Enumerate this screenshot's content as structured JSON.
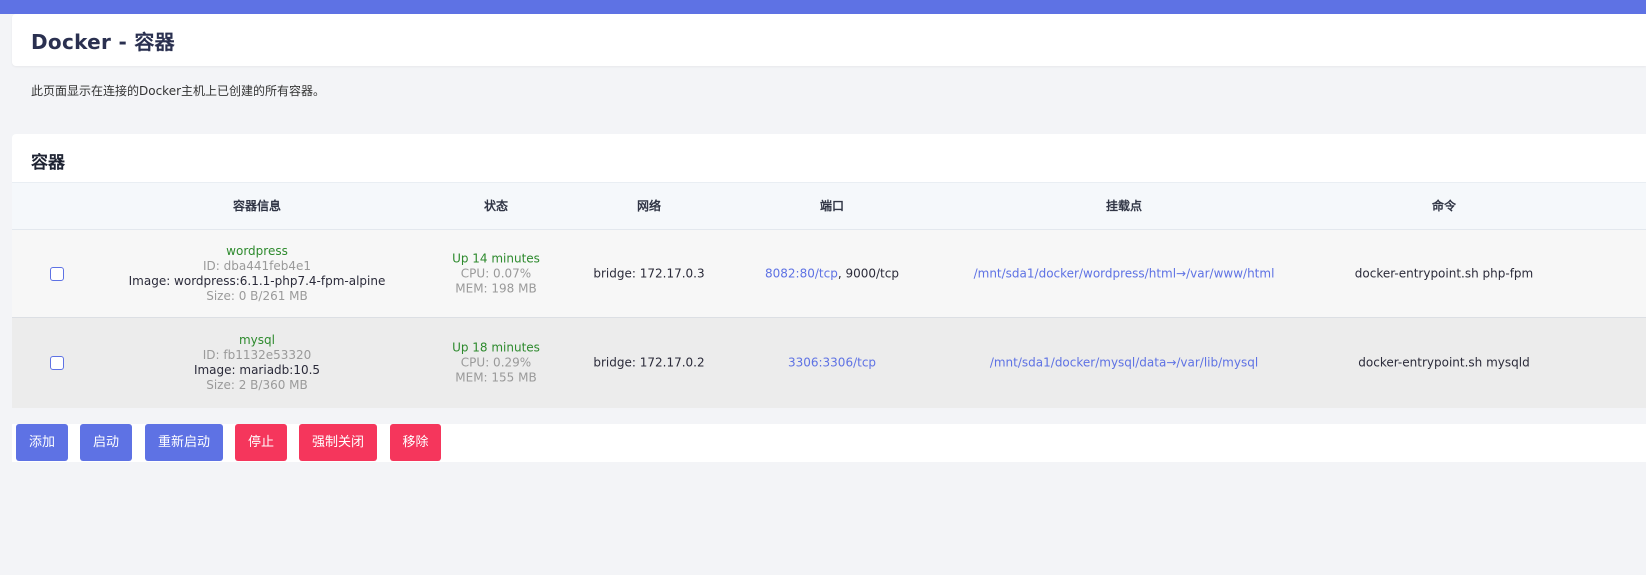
{
  "page": {
    "title": "Docker - 容器",
    "description": "此页面显示在连接的Docker主机上已创建的所有容器。"
  },
  "colors": {
    "accent": "#5e72e4",
    "danger": "#f5365c",
    "running": "#2d8a2d"
  },
  "card": {
    "title": "容器"
  },
  "table": {
    "headers": [
      "容器信息",
      "状态",
      "网络",
      "端口",
      "挂载点",
      "命令"
    ],
    "rows": [
      {
        "name": "wordpress",
        "id": "ID: dba441feb4e1",
        "image": "Image: wordpress:6.1.1-php7.4-fpm-alpine",
        "size": "Size: 0 B/261 MB",
        "status": "Up 14 minutes",
        "cpu": "CPU: 0.07%",
        "mem": "MEM: 198 MB",
        "network": "bridge: 172.17.0.3",
        "port_link": "8082:80/tcp",
        "port_sep": ", ",
        "port_plain": "9000/tcp",
        "mount": "/mnt/sda1/docker/wordpress/html→/var/www/html",
        "command": "docker-entrypoint.sh php-fpm"
      },
      {
        "name": "mysql",
        "id": "ID: fb1132e53320",
        "image": "Image: mariadb:10.5",
        "size": "Size: 2 B/360 MB",
        "status": "Up 18 minutes",
        "cpu": "CPU: 0.29%",
        "mem": "MEM: 155 MB",
        "network": "bridge: 172.17.0.2",
        "port_link": "3306:3306/tcp",
        "port_sep": "",
        "port_plain": "",
        "mount": "/mnt/sda1/docker/mysql/data→/var/lib/mysql",
        "command": "docker-entrypoint.sh mysqld"
      }
    ]
  },
  "actions": {
    "add": "添加",
    "start": "启动",
    "restart": "重新启动",
    "stop": "停止",
    "kill": "强制关闭",
    "remove": "移除"
  }
}
